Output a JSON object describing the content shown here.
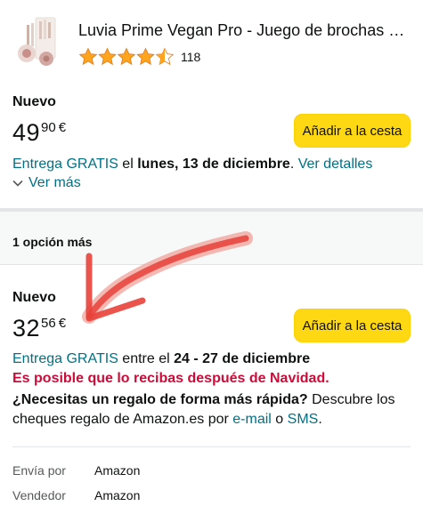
{
  "product": {
    "title": "Luvia Prime Vegan Pro - Juego de brochas de…",
    "rating": 4.5,
    "review_count": "118"
  },
  "offers": [
    {
      "condition": "Nuevo",
      "price_whole": "49",
      "price_fraction": "90",
      "currency": "€",
      "button_label": "Añadir a la cesta",
      "delivery": {
        "free": "Entrega GRATIS",
        "mid": " el ",
        "date": "lunes, 13 de diciembre",
        "end": ". ",
        "details_link": "Ver detalles"
      },
      "see_more": "Ver más"
    },
    {
      "condition": "Nuevo",
      "price_whole": "32",
      "price_fraction": "56",
      "currency": "€",
      "button_label": "Añadir a la cesta",
      "delivery": {
        "free": "Entrega GRATIS",
        "mid": " entre el ",
        "date": "24 - 27 de diciembre"
      },
      "warning": "Es posible que lo recibas después de Navidad.",
      "gift": {
        "question": "¿Necesitas un regalo de forma más rápida?",
        "text1": " Descubre los",
        "text2": "cheques regalo de Amazon.es por ",
        "email_link": "e-mail",
        "or": " o ",
        "sms_link": "SMS",
        "end": "."
      },
      "ships_from_label": "Envía por",
      "ships_from": "Amazon",
      "sold_by_label": "Vendedor",
      "sold_by": "Amazon"
    }
  ],
  "more_options": "1 opción más",
  "colors": {
    "link": "#007185",
    "button": "#FFD814",
    "star": "#FFA41C",
    "warning": "#CC0C39",
    "annotation_arrow": "#E8413A"
  }
}
